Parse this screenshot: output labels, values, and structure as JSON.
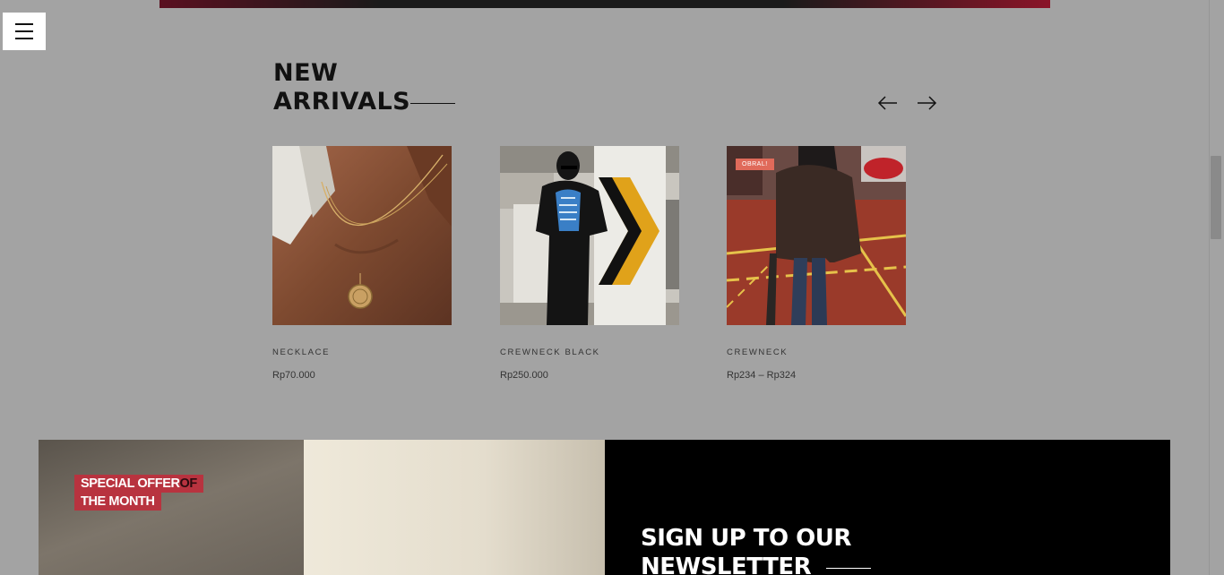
{
  "nav": {
    "menu_icon": "hamburger-menu-icon"
  },
  "new_arrivals": {
    "title_line1": "NEW",
    "title_line2": "ARRIVALS",
    "prev_icon": "arrow-left-icon",
    "next_icon": "arrow-right-icon",
    "products": [
      {
        "name": "NECKLACE",
        "price": "Rp70.000",
        "badge": ""
      },
      {
        "name": "CREWNECK BLACK",
        "price": "Rp250.000",
        "badge": ""
      },
      {
        "name": "CREWNECK",
        "price": "Rp234 – Rp324",
        "badge": "OBRAL!"
      }
    ]
  },
  "promo": {
    "offer_line1": "SPECIAL OFFER",
    "offer_of": "OF",
    "offer_line2": "THE MONTH"
  },
  "newsletter": {
    "title_line1": "SIGN UP TO OUR",
    "title_line2": "NEWSLETTER"
  },
  "colors": {
    "background": "#a3a3a3",
    "accent_red": "#b8333f",
    "badge": "#e06a5a",
    "newsletter_bg": "#000000"
  }
}
